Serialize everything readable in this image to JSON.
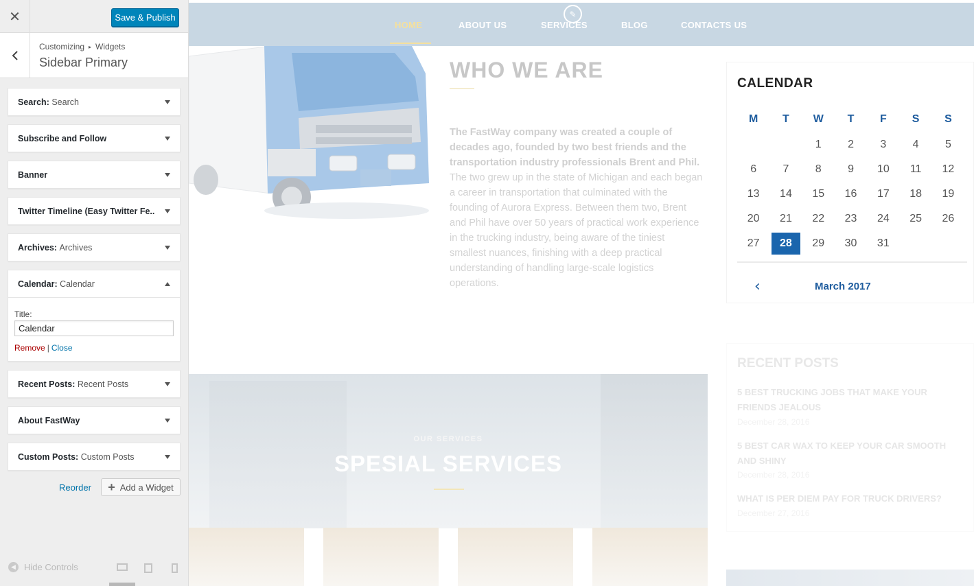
{
  "customizer": {
    "close_icon": "close-icon",
    "save_label": "Save & Publish",
    "breadcrumb_root": "Customizing",
    "breadcrumb_child": "Widgets",
    "section_title": "Sidebar Primary",
    "widgets": [
      {
        "name": "Search:",
        "instance": "Search"
      },
      {
        "name": "Subscribe and Follow",
        "instance": ""
      },
      {
        "name": "Banner",
        "instance": ""
      },
      {
        "name": "Twitter Timeline (Easy Twitter Fe...",
        "instance": ""
      },
      {
        "name": "Archives:",
        "instance": "Archives"
      },
      {
        "name": "Calendar:",
        "instance": "Calendar"
      },
      {
        "name": "Recent Posts:",
        "instance": "Recent Posts"
      },
      {
        "name": "About FastWay",
        "instance": ""
      },
      {
        "name": "Custom Posts:",
        "instance": "Custom Posts"
      }
    ],
    "expanded_widget": {
      "title_label": "Title:",
      "title_value": "Calendar",
      "remove_label": "Remove",
      "separator": "|",
      "close_label": "Close"
    },
    "reorder_label": "Reorder",
    "add_widget_label": "Add a Widget",
    "hide_controls_label": "Hide Controls"
  },
  "site": {
    "nav": [
      "HOME",
      "ABOUT US",
      "SERVICES",
      "BLOG",
      "CONTACTS US"
    ],
    "who_title": "WHO WE ARE",
    "who_text_bold": "The FastWay company was created a couple of decades ago, founded by two best  friends and the transportation industry professionals Brent and Phil.",
    "who_text": "The two grew up in the state of Michigan and each began a career in transportation that culminated with the founding of Aurora Express. Between them two, Brent and Phil have over 50 years of practical work experience in the trucking industry, being aware of the tiniest smallest nuances, finishing with a deep practical understanding of handling large-scale logistics operations.",
    "calendar": {
      "title": "CALENDAR",
      "weekdays": [
        "M",
        "T",
        "W",
        "T",
        "F",
        "S",
        "S"
      ],
      "weeks": [
        [
          "",
          "",
          "1",
          "2",
          "3",
          "4",
          "5"
        ],
        [
          "6",
          "7",
          "8",
          "9",
          "10",
          "11",
          "12"
        ],
        [
          "13",
          "14",
          "15",
          "16",
          "17",
          "18",
          "19"
        ],
        [
          "20",
          "21",
          "22",
          "23",
          "24",
          "25",
          "26"
        ],
        [
          "27",
          "28",
          "29",
          "30",
          "31",
          "",
          ""
        ]
      ],
      "today": "28",
      "month": "March 2017",
      "accent_color": "#1a65ad"
    },
    "recent_posts": {
      "title": "RECENT POSTS",
      "posts": [
        {
          "title": "5 BEST TRUCKING JOBS THAT MAKE YOUR FRIENDS JEALOUS",
          "date": "December 28, 2016"
        },
        {
          "title": "5 BEST CAR WAX TO KEEP YOUR CAR SMOOTH AND SHINY",
          "date": "December 28, 2016"
        },
        {
          "title": "WHAT IS PER DIEM PAY FOR TRUCK DRIVERS?",
          "date": "December 27, 2016"
        }
      ]
    },
    "services": {
      "kicker": "OUR SERVICES",
      "title": "SPESIAL SERVICES"
    }
  }
}
